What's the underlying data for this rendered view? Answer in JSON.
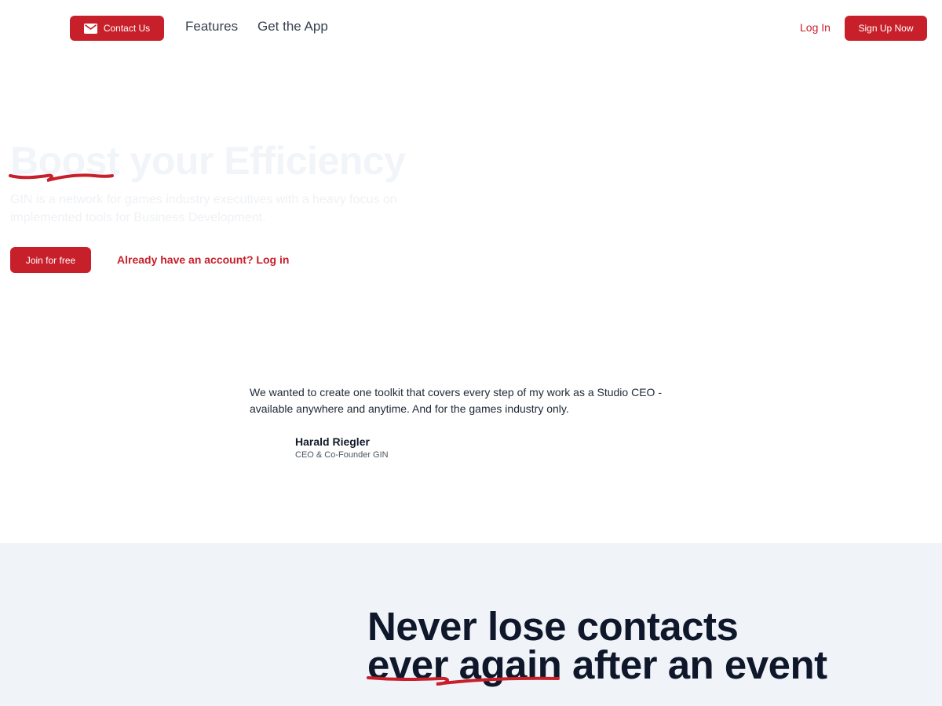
{
  "header": {
    "contact_label": "Contact Us",
    "nav": {
      "features": "Features",
      "get_app": "Get the App"
    },
    "login_label": "Log In",
    "signup_label": "Sign Up Now"
  },
  "hero": {
    "title": "Boost your Efficiency",
    "subtitle": "GIN is a network for games industry executives with a heavy focus on implemented tools for Business Development.",
    "join_label": "Join for free",
    "already_label": "Already have an account? Log in"
  },
  "testimonial": {
    "quote": "We wanted to create one toolkit that covers every step of my work as a Studio CEO - available anywhere and anytime. And for the games industry only.",
    "name": "Harald Riegler",
    "role": "CEO & Co-Founder GIN"
  },
  "contacts": {
    "line1": "Never lose contacts",
    "line2_highlight": "ever again",
    "line2_rest": " after an event"
  },
  "colors": {
    "accent": "#c8202a",
    "section_bg": "#f0f3f8",
    "heading": "#0f172a"
  },
  "icons": {
    "contact": "mail-icon",
    "underline": "squiggle-underline"
  }
}
